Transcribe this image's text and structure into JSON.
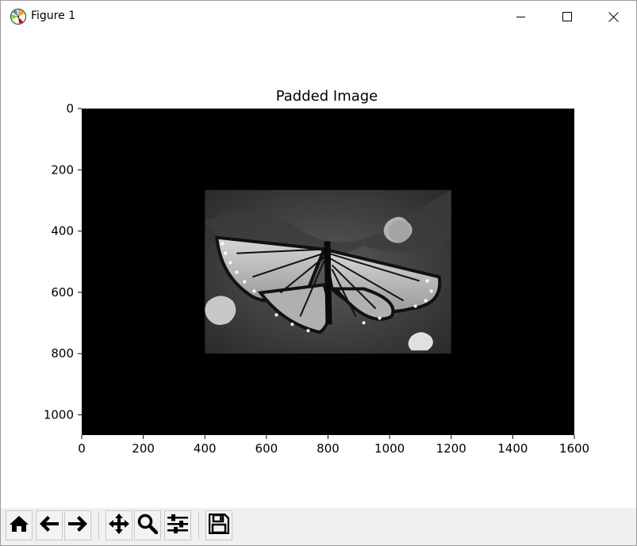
{
  "window": {
    "title": "Figure 1",
    "controls": [
      "minimize-icon",
      "maximize-icon",
      "close-icon"
    ]
  },
  "chart_data": {
    "type": "image",
    "title": "Padded Image",
    "xlabel": "",
    "ylabel": "",
    "xlim": [
      0,
      1600
    ],
    "ylim": [
      1066,
      0
    ],
    "x_ticks": [
      "0",
      "200",
      "400",
      "600",
      "800",
      "1000",
      "1200",
      "1400",
      "1600"
    ],
    "y_ticks": [
      "0",
      "200",
      "400",
      "600",
      "800",
      "1000"
    ],
    "x_tick_values": [
      0,
      200,
      400,
      600,
      800,
      1000,
      1200,
      1400,
      1600
    ],
    "y_tick_values": [
      0,
      200,
      400,
      600,
      800,
      1000
    ],
    "background_color": "#000000",
    "inner_image": {
      "description": "grayscale monarch butterfly photo",
      "x_range": [
        400,
        1200
      ],
      "y_range": [
        266,
        800
      ]
    }
  },
  "toolbar": {
    "buttons": [
      {
        "name": "home-button",
        "icon": "home-icon"
      },
      {
        "name": "back-button",
        "icon": "arrow-left-icon"
      },
      {
        "name": "forward-button",
        "icon": "arrow-right-icon"
      },
      {
        "name": "pan-button",
        "icon": "move-icon"
      },
      {
        "name": "zoom-button",
        "icon": "magnifier-icon"
      },
      {
        "name": "subplots-button",
        "icon": "sliders-icon"
      },
      {
        "name": "save-button",
        "icon": "floppy-disk-icon"
      }
    ]
  }
}
